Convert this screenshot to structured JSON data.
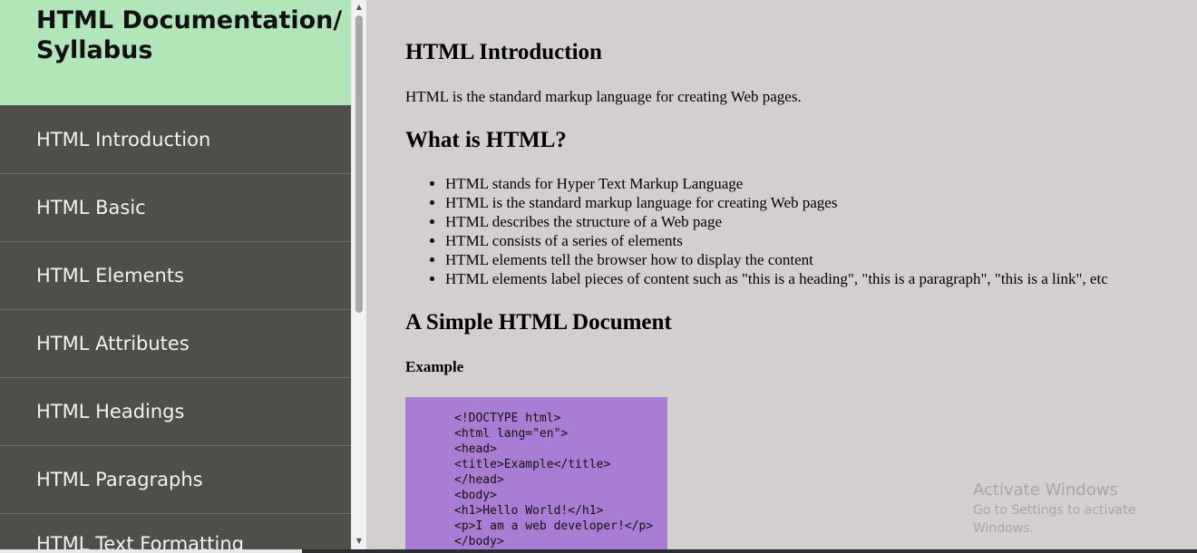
{
  "sidebar": {
    "title": "HTML Documentation/ Syllabus",
    "items": [
      {
        "label": "HTML Introduction"
      },
      {
        "label": "HTML Basic"
      },
      {
        "label": "HTML Elements"
      },
      {
        "label": "HTML Attributes"
      },
      {
        "label": "HTML Headings"
      },
      {
        "label": "HTML Paragraphs"
      },
      {
        "label": "HTML Text Formatting"
      }
    ]
  },
  "main": {
    "heading_intro": "HTML Introduction",
    "intro_text": "HTML is the standard markup language for creating Web pages.",
    "heading_what": "What is HTML?",
    "bullets": [
      "HTML stands for Hyper Text Markup Language",
      "HTML is the standard markup language for creating Web pages",
      "HTML describes the structure of a Web page",
      "HTML consists of a series of elements",
      "HTML elements tell the browser how to display the content",
      "HTML elements label pieces of content such as \"this is a heading\", \"this is a paragraph\", \"this is a link\", etc"
    ],
    "heading_simple": "A Simple HTML Document",
    "example_label": "Example",
    "code_lines": [
      "<!DOCTYPE html>",
      "<html lang=\"en\">",
      "<head>",
      "<title>Example</title>",
      "</head>",
      "<body>",
      "<h1>Hello World!</h1>",
      "<p>I am a web developer!</p>",
      "</body>"
    ]
  },
  "watermark": {
    "title": "Activate Windows",
    "subtitle": "Go to Settings to activate Windows."
  },
  "colors": {
    "sidebar_header_bg": "#b2e6b9",
    "sidebar_bg": "#4f4e48",
    "content_bg": "#d3cfcf",
    "code_bg": "#a87dd4"
  }
}
